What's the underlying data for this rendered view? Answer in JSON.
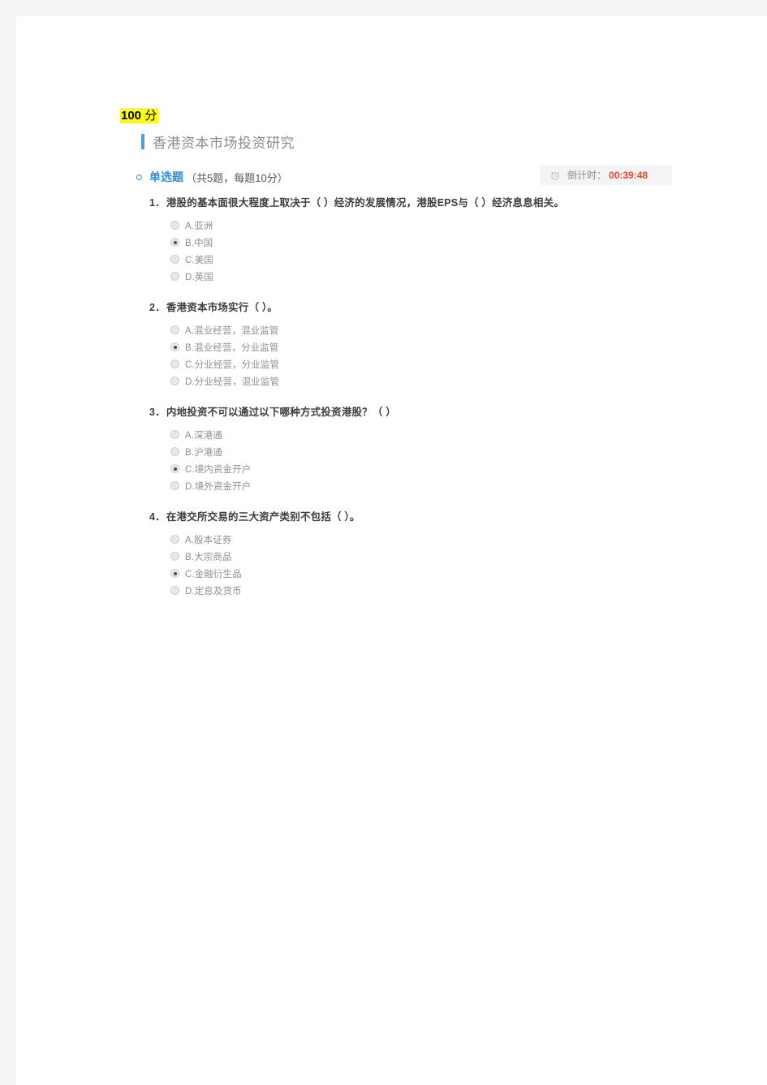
{
  "score": {
    "value": "100",
    "unit": " 分"
  },
  "paper": {
    "title": "香港资本市场投资研究"
  },
  "section": {
    "name": "单选题",
    "meta": "（共5题，每题10分）"
  },
  "timer": {
    "icon": "alarm-clock-icon",
    "label": "倒计时：",
    "value": "00:39:48",
    "value_color": "#f4422e"
  },
  "accent_color": "#2e8ddf",
  "questions": [
    {
      "number": "1．",
      "text": "港股的基本面很大程度上取决于（ ）经济的发展情况，港股EPS与（ ）经济息息相关。",
      "options": [
        {
          "label": "A.亚洲",
          "selected": false
        },
        {
          "label": "B.中国",
          "selected": true
        },
        {
          "label": "C.美国",
          "selected": false
        },
        {
          "label": "D.英国",
          "selected": false
        }
      ]
    },
    {
      "number": "2．",
      "text": "香港资本市场实行（ ）。",
      "options": [
        {
          "label": "A.混业经营，混业监管",
          "selected": false
        },
        {
          "label": "B.混业经营，分业监管",
          "selected": true
        },
        {
          "label": "C.分业经营，分业监管",
          "selected": false
        },
        {
          "label": "D.分业经营，混业监管",
          "selected": false
        }
      ]
    },
    {
      "number": "3．",
      "text": "内地投资不可以通过以下哪种方式投资港股？（ ）",
      "options": [
        {
          "label": "A.深港通",
          "selected": false
        },
        {
          "label": "B.沪港通",
          "selected": false
        },
        {
          "label": "C.境内资金开户",
          "selected": true
        },
        {
          "label": "D.境外资金开户",
          "selected": false
        }
      ]
    },
    {
      "number": "4．",
      "text": "在港交所交易的三大资产类别不包括（ ）。",
      "options": [
        {
          "label": "A.股本证券",
          "selected": false
        },
        {
          "label": "B.大宗商品",
          "selected": false
        },
        {
          "label": "C.金融衍生品",
          "selected": true
        },
        {
          "label": "D.定息及货币",
          "selected": false
        }
      ]
    }
  ]
}
